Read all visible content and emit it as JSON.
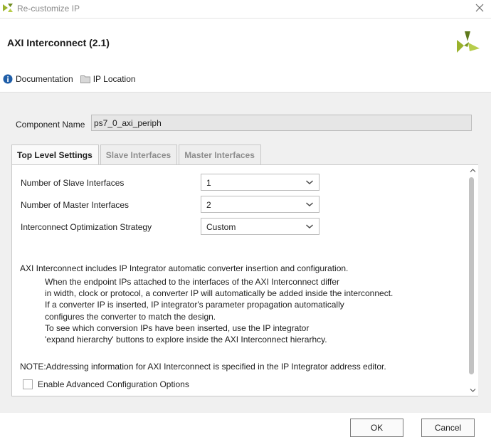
{
  "window": {
    "title": "Re-customize IP",
    "icons": {
      "app": "vivado-logo-icon",
      "close": "close-icon"
    }
  },
  "header": {
    "ip_name": "AXI Interconnect (2.1)",
    "logo_icon": "xilinx-logo-icon"
  },
  "toolbar": {
    "documentation": "Documentation",
    "ip_location": "IP Location",
    "icons": {
      "documentation": "info-icon",
      "ip_location": "folder-icon"
    }
  },
  "component": {
    "label": "Component Name",
    "value": "ps7_0_axi_periph"
  },
  "tabs": [
    {
      "label": "Top Level Settings",
      "active": true
    },
    {
      "label": "Slave Interfaces",
      "active": false
    },
    {
      "label": "Master Interfaces",
      "active": false
    }
  ],
  "settings": {
    "num_slave": {
      "label": "Number of Slave Interfaces",
      "value": "1"
    },
    "num_master": {
      "label": "Number of Master Interfaces",
      "value": "2"
    },
    "strategy": {
      "label": "Interconnect Optimization Strategy",
      "value": "Custom"
    }
  },
  "description": {
    "intro": "AXI Interconnect includes IP Integrator automatic converter insertion and configuration.",
    "lines": [
      "When the endpoint IPs attached to the interfaces of the AXI Interconnect differ",
      "in width, clock or protocol, a converter IP will automatically be added inside the interconnect.",
      "If a converter IP is inserted, IP integrator's parameter propagation automatically",
      "configures the converter to match the design.",
      "To see which conversion IPs have been inserted, use the IP integrator",
      "'expand hierarchy' buttons to explore inside the AXI Interconnect hierarhcy."
    ],
    "note": "NOTE:Addressing information for AXI Interconnect is specified in the IP Integrator address editor."
  },
  "advanced": {
    "label": "Enable Advanced Configuration Options",
    "checked": false
  },
  "buttons": {
    "ok": "OK",
    "cancel": "Cancel"
  },
  "colors": {
    "logo_green": "#9ab22c",
    "logo_dark": "#5f7a1c",
    "info_blue": "#1f5ea8"
  }
}
